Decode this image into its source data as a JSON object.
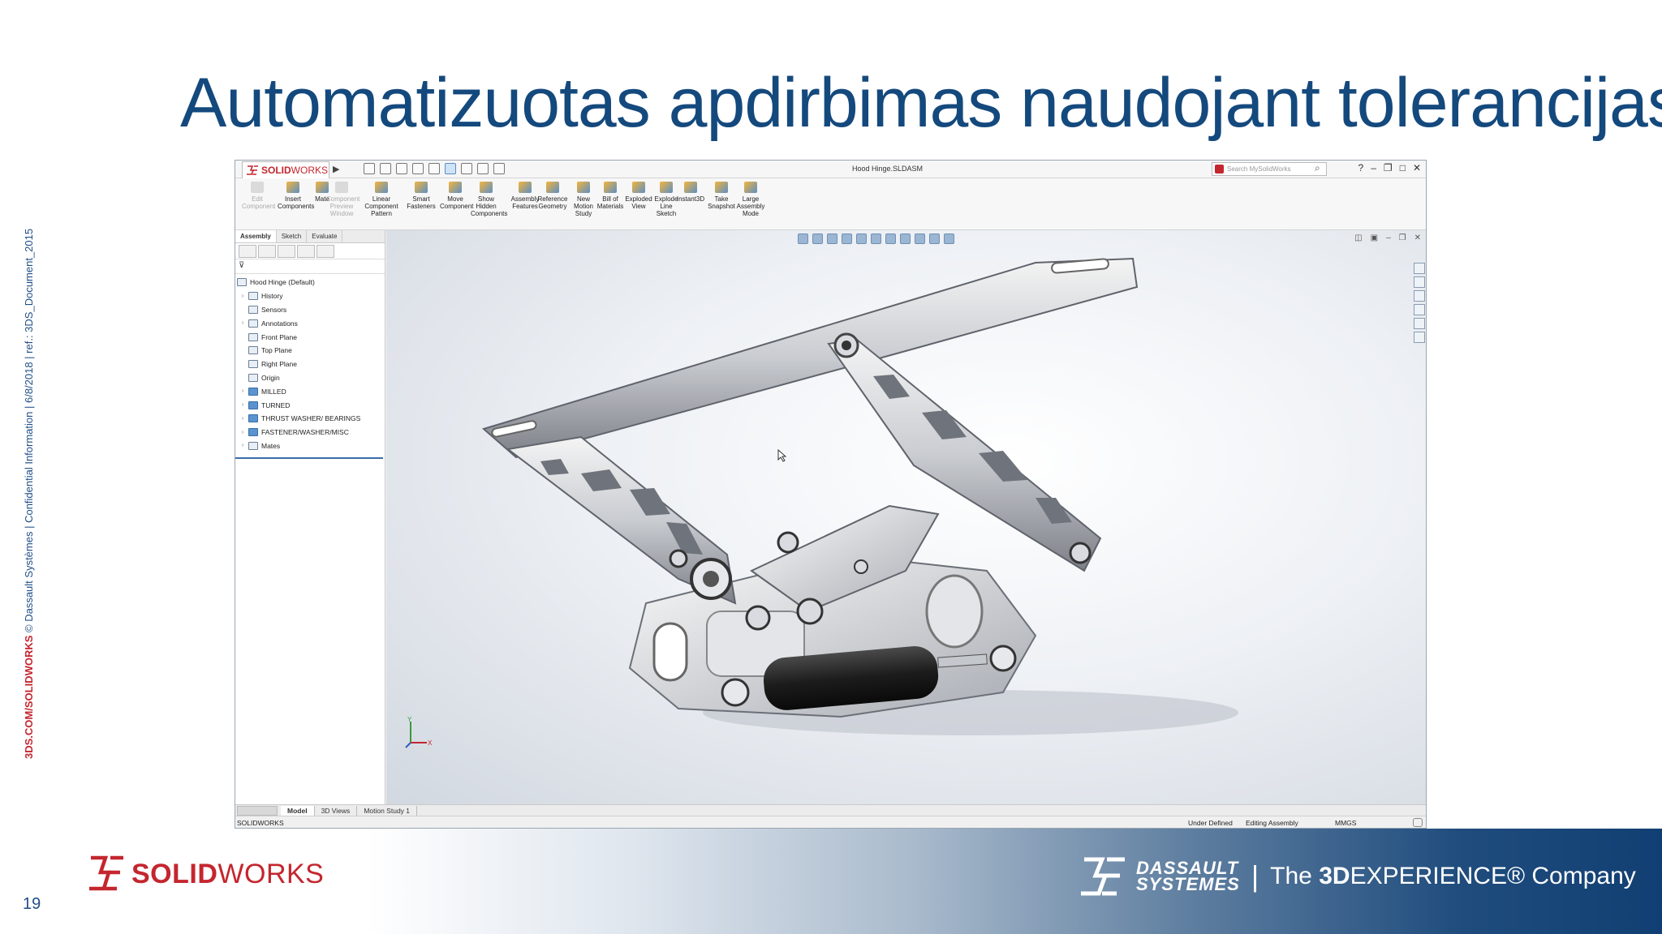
{
  "slide": {
    "title": "Automatizuotas apdirbimas naudojant tolerancijas",
    "side_text_prefix": "3DS.COM/SOLIDWORKS",
    "side_text_rest": " © Dassault Systèmes | Confidential Information | 6/8/2018 | ref.: 3DS_Document_2015",
    "page_number": "19",
    "footer_logo_left_bold": "SOLID",
    "footer_logo_left_rest": "WORKS",
    "footer_logo_right_line1": "DASSAULT",
    "footer_logo_right_line2": "SYSTEMES",
    "footer_separator": "|",
    "footer_tag_pre": "The ",
    "footer_tag_bold": "3D",
    "footer_tag_rest": "EXPERIENCE® Company"
  },
  "app": {
    "logo_bold": "SOLID",
    "logo_rest": "WORKS",
    "title": "Hood Hinge.SLDASM",
    "search_placeholder": "Search MySolidWorks",
    "ribbon": [
      {
        "label": "Edit Component",
        "enabled": false
      },
      {
        "label": "Insert Components",
        "enabled": true
      },
      {
        "label": "Mate",
        "enabled": true
      },
      {
        "label": "Component Preview Window",
        "enabled": false
      },
      {
        "label": "Linear Component Pattern",
        "enabled": true
      },
      {
        "label": "Smart Fasteners",
        "enabled": true
      },
      {
        "label": "Move Component",
        "enabled": true
      },
      {
        "label": "Show Hidden Components",
        "enabled": true
      },
      {
        "label": "Assembly Features",
        "enabled": true
      },
      {
        "label": "Reference Geometry",
        "enabled": true
      },
      {
        "label": "New Motion Study",
        "enabled": true
      },
      {
        "label": "Bill of Materials",
        "enabled": true
      },
      {
        "label": "Exploded View",
        "enabled": true
      },
      {
        "label": "Explode Line Sketch",
        "enabled": true
      },
      {
        "label": "Instant3D",
        "enabled": true
      },
      {
        "label": "Take Snapshot",
        "enabled": true
      },
      {
        "label": "Large Assembly Mode",
        "enabled": true
      }
    ],
    "command_tabs": [
      "Assembly",
      "Sketch",
      "Evaluate"
    ],
    "tree": [
      {
        "label": "Hood Hinge  (Default)",
        "expandable": false,
        "icon": "assembly-icon",
        "indent": 0
      },
      {
        "label": "History",
        "expandable": true,
        "icon": "history-icon",
        "indent": 1
      },
      {
        "label": "Sensors",
        "expandable": false,
        "icon": "sensor-icon",
        "indent": 1
      },
      {
        "label": "Annotations",
        "expandable": true,
        "icon": "annotation-icon",
        "indent": 1
      },
      {
        "label": "Front Plane",
        "expandable": false,
        "icon": "plane-icon",
        "indent": 1
      },
      {
        "label": "Top Plane",
        "expandable": false,
        "icon": "plane-icon",
        "indent": 1
      },
      {
        "label": "Right Plane",
        "expandable": false,
        "icon": "plane-icon",
        "indent": 1
      },
      {
        "label": "Origin",
        "expandable": false,
        "icon": "origin-icon",
        "indent": 1
      },
      {
        "label": "MILLED",
        "expandable": true,
        "icon": "folder-icon",
        "indent": 1
      },
      {
        "label": "TURNED",
        "expandable": true,
        "icon": "folder-icon",
        "indent": 1
      },
      {
        "label": "THRUST WASHER/ BEARINGS",
        "expandable": true,
        "icon": "folder-icon",
        "indent": 1
      },
      {
        "label": "FASTENER/WASHER/MISC",
        "expandable": true,
        "icon": "folder-icon",
        "indent": 1
      },
      {
        "label": "Mates",
        "expandable": true,
        "icon": "mates-icon",
        "indent": 1
      }
    ],
    "bottom_tabs": [
      "Model",
      "3D Views",
      "Motion Study 1"
    ],
    "status": {
      "app_name": "SOLIDWORKS",
      "state": "Under Defined",
      "mode": "Editing Assembly",
      "units": "MMGS"
    },
    "triad_x": "X",
    "triad_y": "Y"
  },
  "colors": {
    "title": "#14497d",
    "brand_red": "#c4262e",
    "footer_dark": "#123f73"
  }
}
